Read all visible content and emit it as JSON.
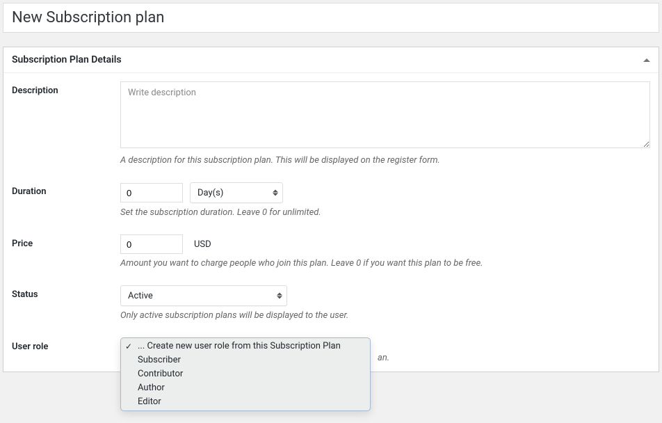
{
  "title": "New Subscription plan",
  "panel": {
    "title": "Subscription Plan Details"
  },
  "fields": {
    "description": {
      "label": "Description",
      "placeholder": "Write description",
      "value": "",
      "hint": "A description for this subscription plan. This will be displayed on the register form."
    },
    "duration": {
      "label": "Duration",
      "value": "0",
      "unit": "Day(s)",
      "hint": "Set the subscription duration. Leave 0 for unlimited."
    },
    "price": {
      "label": "Price",
      "value": "0",
      "currency": "USD",
      "hint": "Amount you want to charge people who join this plan. Leave 0 if you want this plan to be free."
    },
    "status": {
      "label": "Status",
      "value": "Active",
      "hint": "Only active subscription plans will be displayed to the user."
    },
    "user_role": {
      "label": "User role",
      "hint_fragment": "an.",
      "options": [
        "... Create new user role from this Subscription Plan",
        "Subscriber",
        "Contributor",
        "Author",
        "Editor"
      ]
    }
  }
}
